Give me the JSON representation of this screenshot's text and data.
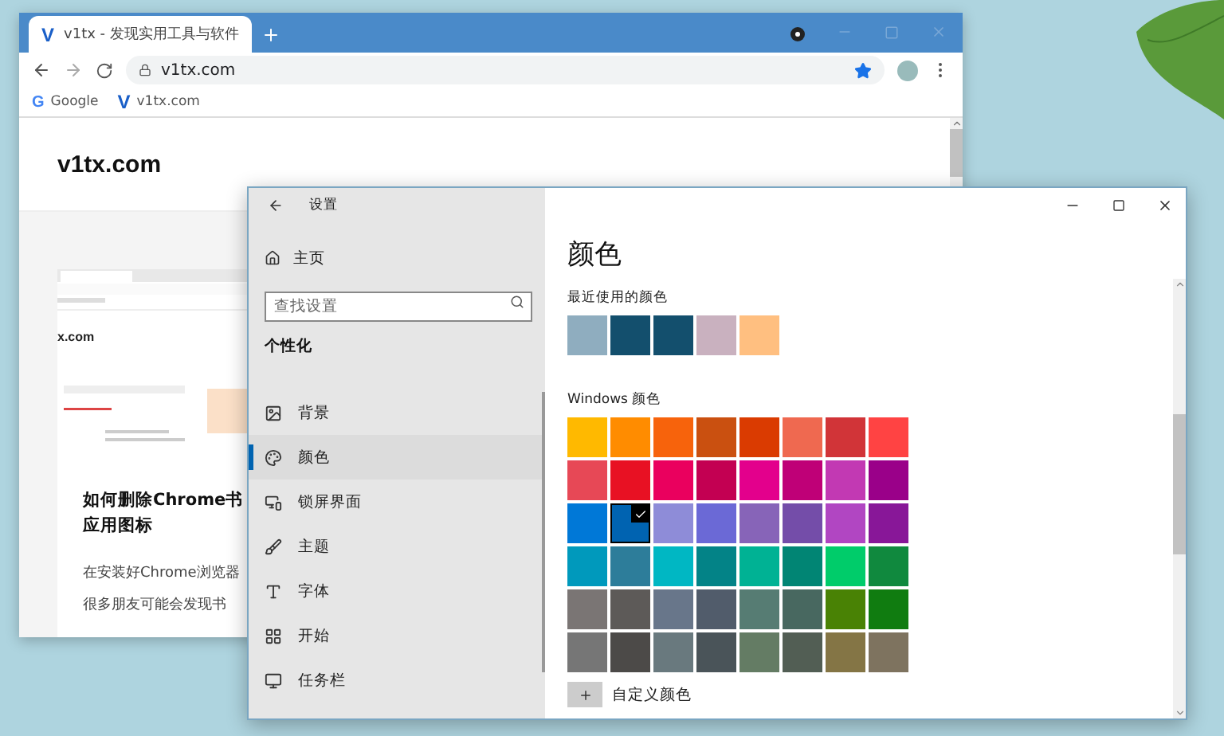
{
  "browser": {
    "tab_logo": "V",
    "tab_title": "v1tx - 发现实用工具与软件",
    "address": "v1tx.com",
    "bookmarks": [
      {
        "logo": "G",
        "label": "Google",
        "kind": "google"
      },
      {
        "logo": "V",
        "label": "v1tx.com",
        "kind": "site"
      }
    ],
    "page": {
      "site_title": "v1tx.com",
      "thumbnail_caption": "x.com",
      "article_title": [
        "如何删除Chrome书",
        "应用图标"
      ],
      "article_text": [
        "在安装好Chrome浏览器",
        "很多朋友可能会发现书"
      ]
    }
  },
  "settings": {
    "title": "设置",
    "home": "主页",
    "search": {
      "placeholder": "查找设置"
    },
    "section": "个性化",
    "nav": [
      {
        "label": "背景",
        "kind": "picture",
        "selected": false
      },
      {
        "label": "颜色",
        "kind": "palette",
        "selected": true
      },
      {
        "label": "锁屏界面",
        "kind": "screen",
        "selected": false
      },
      {
        "label": "主题",
        "kind": "brush",
        "selected": false
      },
      {
        "label": "字体",
        "kind": "font",
        "selected": false
      },
      {
        "label": "开始",
        "kind": "grid",
        "selected": false
      },
      {
        "label": "任务栏",
        "kind": "monitor",
        "selected": false
      }
    ],
    "heading": "颜色",
    "recent_label": "最近使用的颜色",
    "recent": [
      {
        "color": "#8fadbf"
      },
      {
        "color": "#134f6d"
      },
      {
        "color": "#134f6d"
      },
      {
        "color": "#c9b1bf"
      },
      {
        "color": "#ffbf80"
      }
    ],
    "windows_label": "Windows 颜色",
    "swatches": [
      {
        "color": "#ffb900",
        "selected": false
      },
      {
        "color": "#ff8c00",
        "selected": false
      },
      {
        "color": "#f7630c",
        "selected": false
      },
      {
        "color": "#ca5010",
        "selected": false
      },
      {
        "color": "#da3b01",
        "selected": false
      },
      {
        "color": "#ef6950",
        "selected": false
      },
      {
        "color": "#d13438",
        "selected": false
      },
      {
        "color": "#ff4343",
        "selected": false
      },
      {
        "color": "#e74856",
        "selected": false
      },
      {
        "color": "#e81123",
        "selected": false
      },
      {
        "color": "#ea005e",
        "selected": false
      },
      {
        "color": "#c30052",
        "selected": false
      },
      {
        "color": "#e3008c",
        "selected": false
      },
      {
        "color": "#bf0077",
        "selected": false
      },
      {
        "color": "#c239b3",
        "selected": false
      },
      {
        "color": "#9a0089",
        "selected": false
      },
      {
        "color": "#0078d7",
        "selected": false
      },
      {
        "color": "#0063b1",
        "selected": true
      },
      {
        "color": "#8e8cd8",
        "selected": false
      },
      {
        "color": "#6b69d6",
        "selected": false
      },
      {
        "color": "#8764b8",
        "selected": false
      },
      {
        "color": "#744da9",
        "selected": false
      },
      {
        "color": "#b146c2",
        "selected": false
      },
      {
        "color": "#881798",
        "selected": false
      },
      {
        "color": "#0099bc",
        "selected": false
      },
      {
        "color": "#2d7d9a",
        "selected": false
      },
      {
        "color": "#00b7c3",
        "selected": false
      },
      {
        "color": "#038387",
        "selected": false
      },
      {
        "color": "#00b294",
        "selected": false
      },
      {
        "color": "#018574",
        "selected": false
      },
      {
        "color": "#00cc6a",
        "selected": false
      },
      {
        "color": "#10893e",
        "selected": false
      },
      {
        "color": "#7a7574",
        "selected": false
      },
      {
        "color": "#5d5a58",
        "selected": false
      },
      {
        "color": "#68768a",
        "selected": false
      },
      {
        "color": "#515c6b",
        "selected": false
      },
      {
        "color": "#567c73",
        "selected": false
      },
      {
        "color": "#486860",
        "selected": false
      },
      {
        "color": "#498205",
        "selected": false
      },
      {
        "color": "#107c10",
        "selected": false
      },
      {
        "color": "#767676",
        "selected": false
      },
      {
        "color": "#4c4a48",
        "selected": false
      },
      {
        "color": "#69797e",
        "selected": false
      },
      {
        "color": "#4a5459",
        "selected": false
      },
      {
        "color": "#647c64",
        "selected": false
      },
      {
        "color": "#525e54",
        "selected": false
      },
      {
        "color": "#847545",
        "selected": false
      },
      {
        "color": "#7e735f",
        "selected": false
      }
    ],
    "custom_label": "自定义颜色"
  }
}
